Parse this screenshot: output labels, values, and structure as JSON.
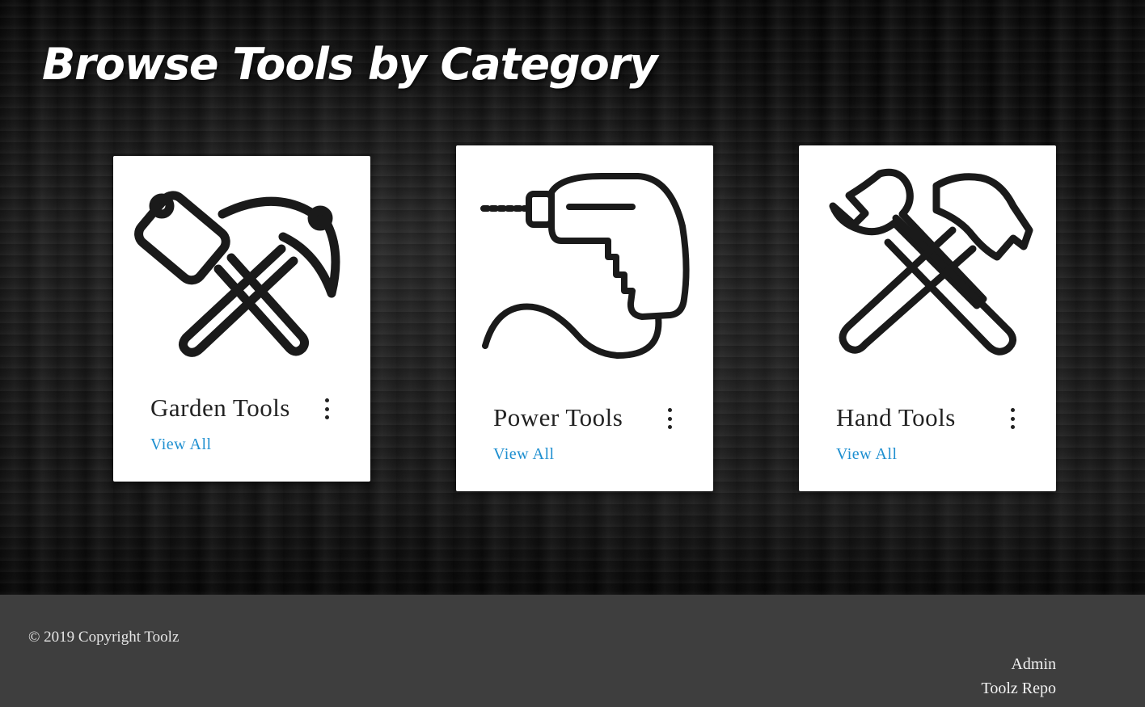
{
  "header": {
    "title": "Browse Tools by Category"
  },
  "categories": [
    {
      "name": "Garden Tools",
      "link": "View All",
      "icon": "pickaxe-mallet-icon"
    },
    {
      "name": "Power Tools",
      "link": "View All",
      "icon": "power-drill-icon"
    },
    {
      "name": "Hand Tools",
      "link": "View All",
      "icon": "wrench-hammer-icon"
    }
  ],
  "footer": {
    "copyright": "© 2019 Copyright Toolz",
    "links": [
      "Admin",
      "Toolz Repo"
    ]
  },
  "colors": {
    "link": "#1e8fd0",
    "footer_bg": "#3e3e3e",
    "card_bg": "#ffffff"
  }
}
